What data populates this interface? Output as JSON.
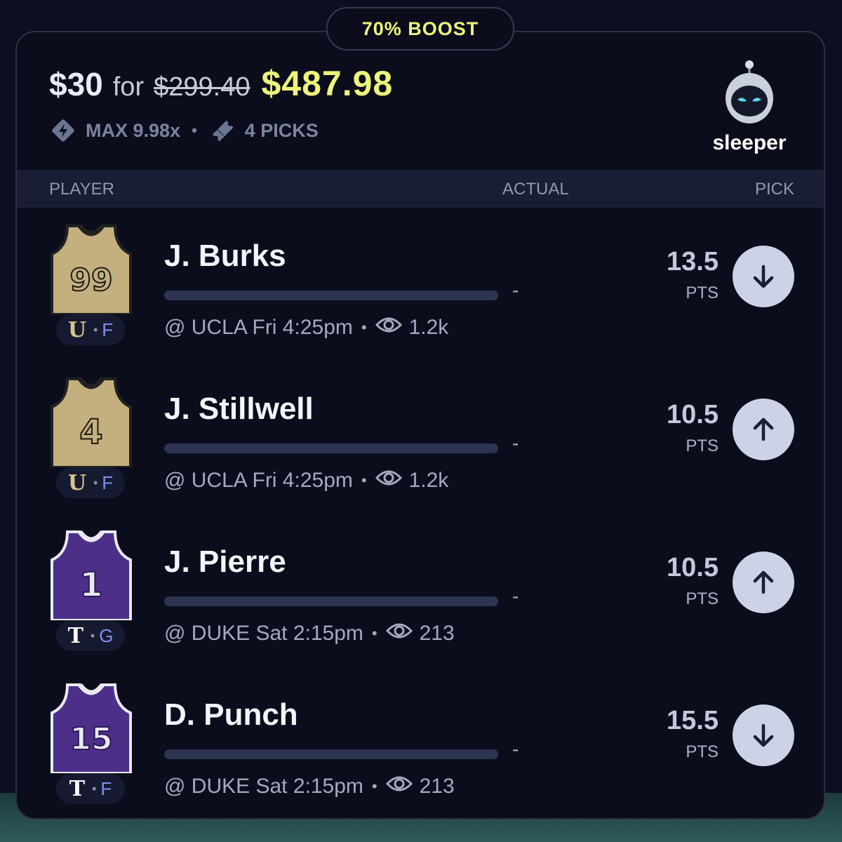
{
  "boost_label": "70% BOOST",
  "header": {
    "stake": "$30",
    "for_word": "for",
    "old_payout": "$299.40",
    "new_payout": "$487.98",
    "max_multiplier": "MAX 9.98x",
    "picks_count": "4 PICKS",
    "separator": "•",
    "brand": "sleeper"
  },
  "columns": {
    "player": "PLAYER",
    "actual": "ACTUAL",
    "pick": "PICK"
  },
  "players": [
    {
      "name": "J. Burks",
      "jersey_number": "99",
      "team_letter": "U",
      "position": "F",
      "matchup": "@ UCLA Fri 4:25pm",
      "views": "1.2k",
      "actual": "-",
      "line": "13.5",
      "unit": "PTS",
      "pick": "under",
      "pick_icon": "arrow-down-icon",
      "jersey_color": "#c4b07e",
      "team_color": "#d8c48e",
      "progress": 0
    },
    {
      "name": "J. Stillwell",
      "jersey_number": "4",
      "team_letter": "U",
      "position": "F",
      "matchup": "@ UCLA Fri 4:25pm",
      "views": "1.2k",
      "actual": "-",
      "line": "10.5",
      "unit": "PTS",
      "pick": "over",
      "pick_icon": "arrow-up-icon",
      "jersey_color": "#c4b07e",
      "team_color": "#d8c48e",
      "progress": 0
    },
    {
      "name": "J. Pierre",
      "jersey_number": "1",
      "team_letter": "T",
      "position": "G",
      "matchup": "@ DUKE Sat 2:15pm",
      "views": "213",
      "actual": "-",
      "line": "10.5",
      "unit": "PTS",
      "pick": "over",
      "pick_icon": "arrow-up-icon",
      "jersey_color": "#4d2f8a",
      "team_color": "#ffffff",
      "progress": 0
    },
    {
      "name": "D. Punch",
      "jersey_number": "15",
      "team_letter": "T",
      "position": "F",
      "matchup": "@ DUKE Sat 2:15pm",
      "views": "213",
      "actual": "-",
      "line": "15.5",
      "unit": "PTS",
      "pick": "under",
      "pick_icon": "arrow-down-icon",
      "jersey_color": "#4d2f8a",
      "team_color": "#ffffff",
      "progress": 0
    }
  ],
  "colors": {
    "accent": "#eef37a",
    "background": "#0b0d1c",
    "muted": "#7a849f"
  }
}
